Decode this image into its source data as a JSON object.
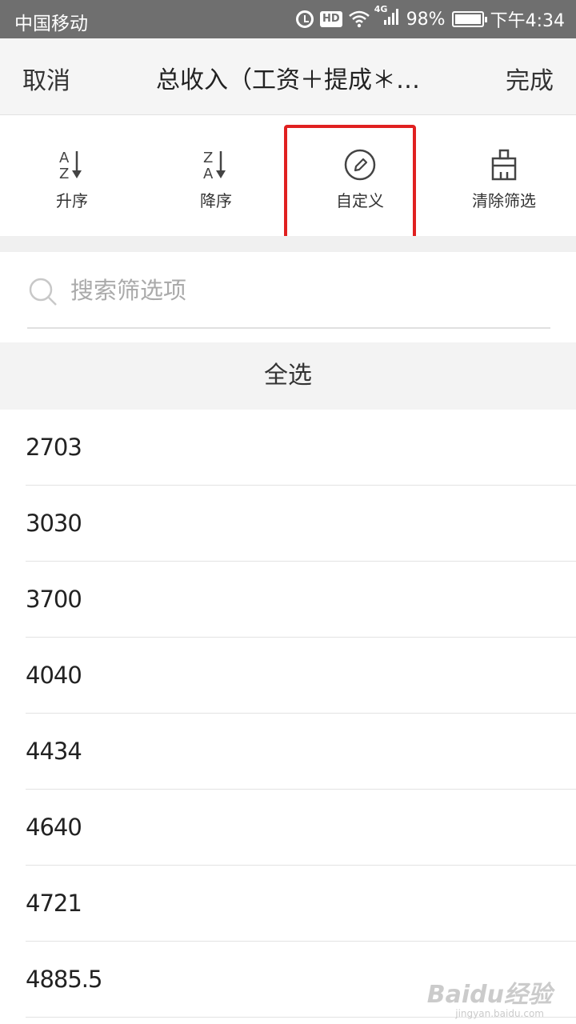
{
  "status_bar": {
    "carrier": "中国移动",
    "network": "4G",
    "battery": "98%",
    "time": "下午4:34",
    "hd_label": "HD",
    "icons": [
      "alarm-icon",
      "hd-icon",
      "wifi-icon",
      "signal-icon",
      "battery-icon"
    ]
  },
  "header": {
    "cancel_label": "取消",
    "title": "总收入（工资＋提成＊…",
    "done_label": "完成"
  },
  "toolbar": {
    "items": [
      {
        "label": "升序",
        "icon": "sort-ascending-icon"
      },
      {
        "label": "降序",
        "icon": "sort-descending-icon"
      },
      {
        "label": "自定义",
        "icon": "edit-pencil-icon"
      },
      {
        "label": "清除筛选",
        "icon": "clear-filter-icon"
      }
    ],
    "highlight_color": "#e02020"
  },
  "search": {
    "placeholder": "搜索筛选项",
    "value": ""
  },
  "select_all_label": "全选",
  "values": [
    "2703",
    "3030",
    "3700",
    "4040",
    "4434",
    "4640",
    "4721",
    "4885.5"
  ],
  "watermark": {
    "text": "Baidu经验",
    "sub": "jingyan.baidu.com"
  }
}
